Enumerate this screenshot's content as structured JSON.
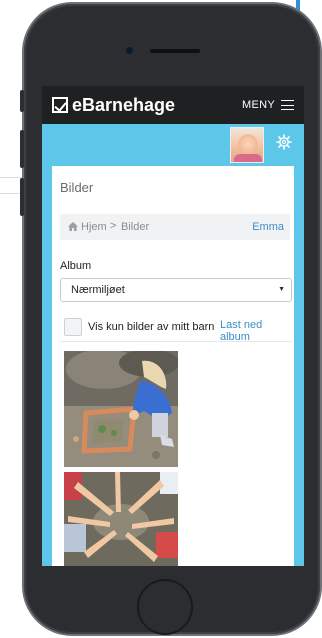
{
  "app": {
    "logo_text": "eBarnehage",
    "menu_label": "MENY"
  },
  "page": {
    "title": "Bilder"
  },
  "breadcrumb": {
    "home": "Hjem",
    "separator": ">",
    "current": "Bilder",
    "user": "Emma"
  },
  "album": {
    "label": "Album",
    "selected": "Nærmiljøet"
  },
  "filter": {
    "checkbox_label": "Vis kun bilder av mitt barn",
    "checked": false,
    "download_label": "Last ned album"
  },
  "colors": {
    "topbar": "#1f2021",
    "accent_bg": "#5cc7e8",
    "link": "#3b8ec9"
  },
  "icons": [
    "logo-check-icon",
    "hamburger-icon",
    "gear-icon",
    "home-icon",
    "select-arrow-icon"
  ]
}
